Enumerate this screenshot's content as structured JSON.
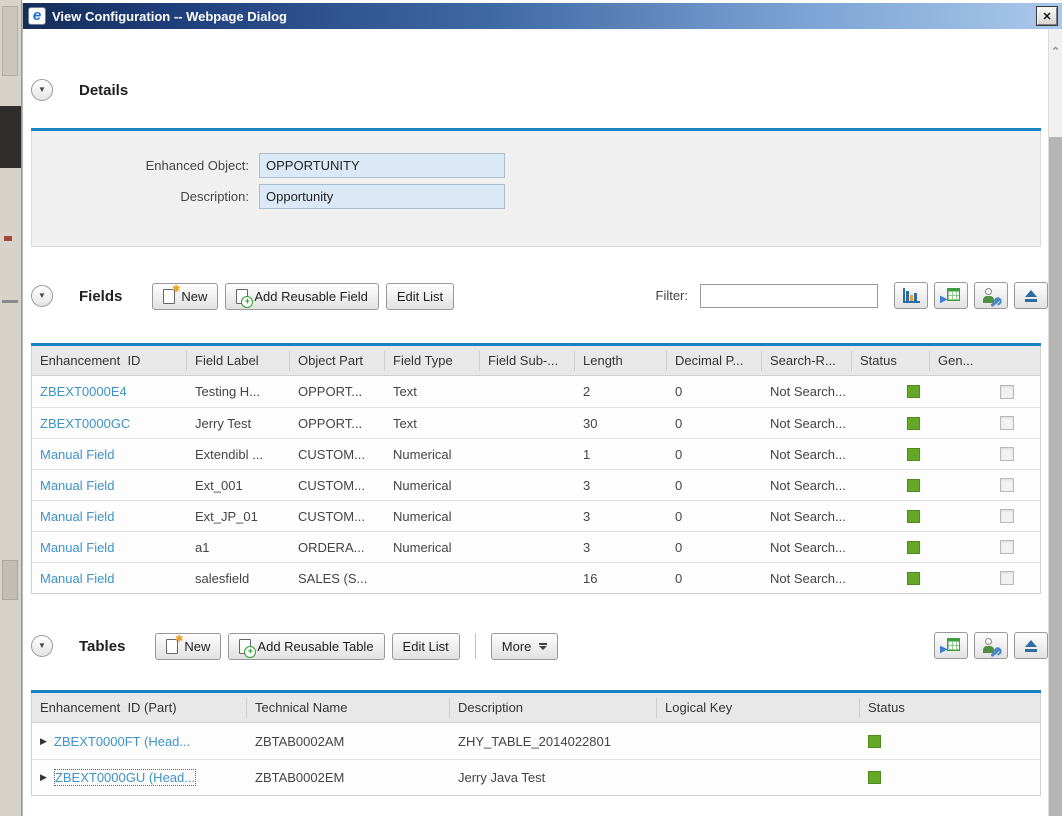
{
  "colors": {
    "accent_blue": "#1583c4",
    "link_blue": "#3e93c9",
    "status_green": "#65a826",
    "titlebar_dark": "#142e58",
    "titlebar_light": "#a9c8ea",
    "detail_input_bg": "#dbe8f5"
  },
  "icons": {
    "collapse": "▼",
    "row_expand": "▶",
    "close": "✕",
    "ie_logo": "e",
    "scroll_up": "⌃"
  },
  "window": {
    "title": "View Configuration -- Webpage Dialog"
  },
  "details": {
    "title": "Details",
    "rows": [
      {
        "label": "Enhanced Object:",
        "value": "OPPORTUNITY"
      },
      {
        "label": "Description:",
        "value": "Opportunity"
      }
    ]
  },
  "fields": {
    "title": "Fields",
    "new_label": "New",
    "add_label": "Add Reusable Field",
    "edit_label": "Edit List",
    "filter_label": "Filter:",
    "filter_value": "",
    "columns": [
      "Enhancement  ID",
      "Field Label",
      "Object Part",
      "Field Type",
      "Field Sub-...",
      "Length",
      "Decimal P...",
      "Search-R...",
      "Status",
      "Gen..."
    ],
    "rows": [
      [
        "ZBEXT0000E4",
        "Testing H...",
        "OPPORT...",
        "Text",
        "",
        "2",
        "0",
        "Not Search..."
      ],
      [
        "ZBEXT0000GC",
        "Jerry Test",
        "OPPORT...",
        "Text",
        "",
        "30",
        "0",
        "Not Search..."
      ],
      [
        "Manual Field",
        "Extendibl ...",
        "CUSTOM...",
        "Numerical",
        "",
        "1",
        "0",
        "Not Search..."
      ],
      [
        "Manual Field",
        "Ext_001",
        "CUSTOM...",
        "Numerical",
        "",
        "3",
        "0",
        "Not Search..."
      ],
      [
        "Manual Field",
        "Ext_JP_01",
        "CUSTOM...",
        "Numerical",
        "",
        "3",
        "0",
        "Not Search..."
      ],
      [
        "Manual Field",
        "a1",
        "ORDERA...",
        "Numerical",
        "",
        "3",
        "0",
        "Not Search..."
      ],
      [
        "Manual Field",
        "salesfield",
        "SALES (S...",
        "",
        "",
        "16",
        "0",
        "Not Search..."
      ]
    ],
    "row_status": "green",
    "row_generated_checked": false
  },
  "tables": {
    "title": "Tables",
    "new_label": "New",
    "add_label": "Add Reusable Table",
    "edit_label": "Edit List",
    "more_label": "More",
    "columns": [
      "Enhancement  ID (Part)",
      "Technical Name",
      "Description",
      "Logical Key",
      "Status"
    ],
    "rows": [
      {
        "id": "ZBEXT0000FT (Head...",
        "tech": "ZBTAB0002AM",
        "desc": "ZHY_TABLE_2014022801",
        "key": "",
        "status": "green",
        "focused": false
      },
      {
        "id": "ZBEXT0000GU (Head...",
        "tech": "ZBTAB0002EM",
        "desc": "Jerry Java Test",
        "key": "",
        "status": "green",
        "focused": true
      }
    ]
  }
}
